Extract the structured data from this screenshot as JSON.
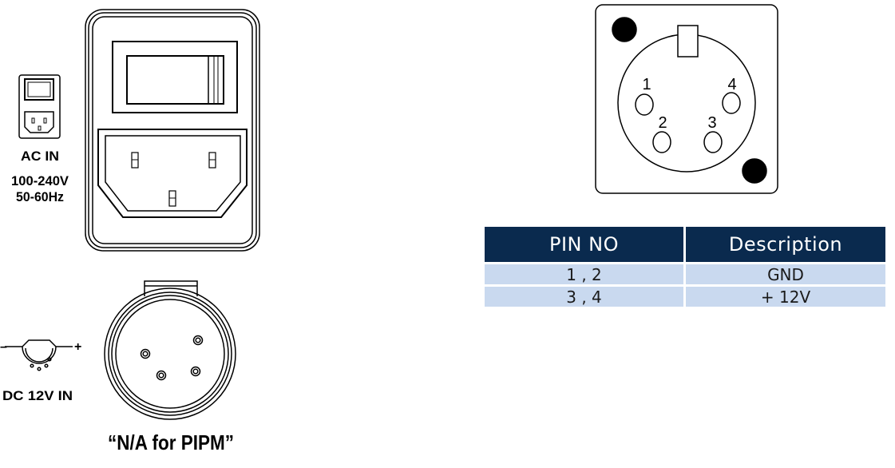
{
  "ac_inlet": {
    "label": "AC IN",
    "voltage": "100-240V",
    "frequency": "50-60Hz"
  },
  "dc_inlet": {
    "label": "DC 12V IN",
    "minus_symbol": "–",
    "plus_symbol": "+",
    "note": "“N/A for PIPM”"
  },
  "xlr_connector": {
    "pin_labels": [
      "1",
      "2",
      "3",
      "4"
    ]
  },
  "pin_table": {
    "headers": [
      "PIN NO",
      "Description"
    ],
    "rows": [
      {
        "pins": "1 , 2",
        "description": "GND"
      },
      {
        "pins": "3 , 4",
        "description": "+ 12V"
      }
    ],
    "header_color": "#0a2a4e",
    "row_color": "#c9d9ef"
  }
}
